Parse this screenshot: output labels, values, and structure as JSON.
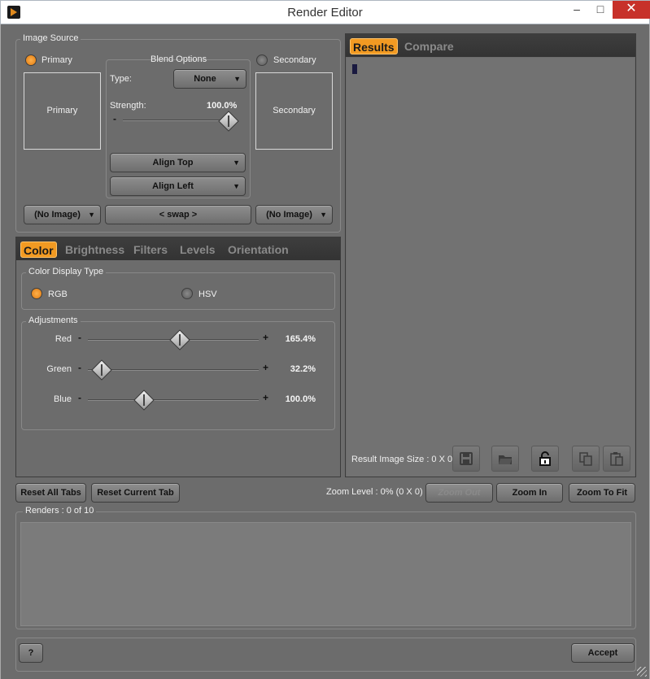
{
  "window": {
    "title": "Render Editor"
  },
  "image_source": {
    "label": "Image Source",
    "primary": {
      "radio_label": "Primary",
      "box_label": "Primary",
      "selected": true,
      "image_combo": "(No Image)"
    },
    "secondary": {
      "radio_label": "Secondary",
      "box_label": "Secondary",
      "selected": false,
      "image_combo": "(No Image)"
    },
    "swap_label": "< swap >",
    "blend": {
      "label": "Blend Options",
      "type_label": "Type:",
      "type_value": "None",
      "strength_label": "Strength:",
      "strength_value": "100.0%",
      "strength_fraction": 1.0,
      "align_top": "Align Top",
      "align_left": "Align Left"
    }
  },
  "adjust_tabs": [
    {
      "label": "Color",
      "active": true
    },
    {
      "label": "Brightness",
      "active": false
    },
    {
      "label": "Filters",
      "active": false
    },
    {
      "label": "Levels",
      "active": false
    },
    {
      "label": "Orientation",
      "active": false
    }
  ],
  "color_display": {
    "label": "Color Display Type",
    "rgb_label": "RGB",
    "hsv_label": "HSV",
    "selected": "RGB"
  },
  "adjustments": {
    "label": "Adjustments",
    "sliders": [
      {
        "name": "Red",
        "value": "165.4%",
        "fraction": 0.54
      },
      {
        "name": "Green",
        "value": "32.2%",
        "fraction": 0.08
      },
      {
        "name": "Blue",
        "value": "100.0%",
        "fraction": 0.33
      }
    ]
  },
  "result_tabs": [
    {
      "label": "Results",
      "active": true
    },
    {
      "label": "Compare",
      "active": false
    }
  ],
  "result_info": {
    "size_text": "Result Image Size : 0 X 0"
  },
  "result_icons": [
    "save-icon",
    "open-folder-icon",
    "lock-icon",
    "copy-icon",
    "paste-icon"
  ],
  "bottom_bar": {
    "reset_all": "Reset All Tabs",
    "reset_current": "Reset Current Tab",
    "zoom_level": "Zoom Level : 0% (0 X 0)",
    "zoom_out": "Zoom Out",
    "zoom_in": "Zoom In",
    "zoom_fit": "Zoom To Fit"
  },
  "renders": {
    "label": "Renders : 0 of 10"
  },
  "footer": {
    "help_label": "?",
    "accept": "Accept"
  },
  "colors": {
    "accent": "#f29a22",
    "panel": "#6c6c6c",
    "tabbar": "#383838"
  }
}
